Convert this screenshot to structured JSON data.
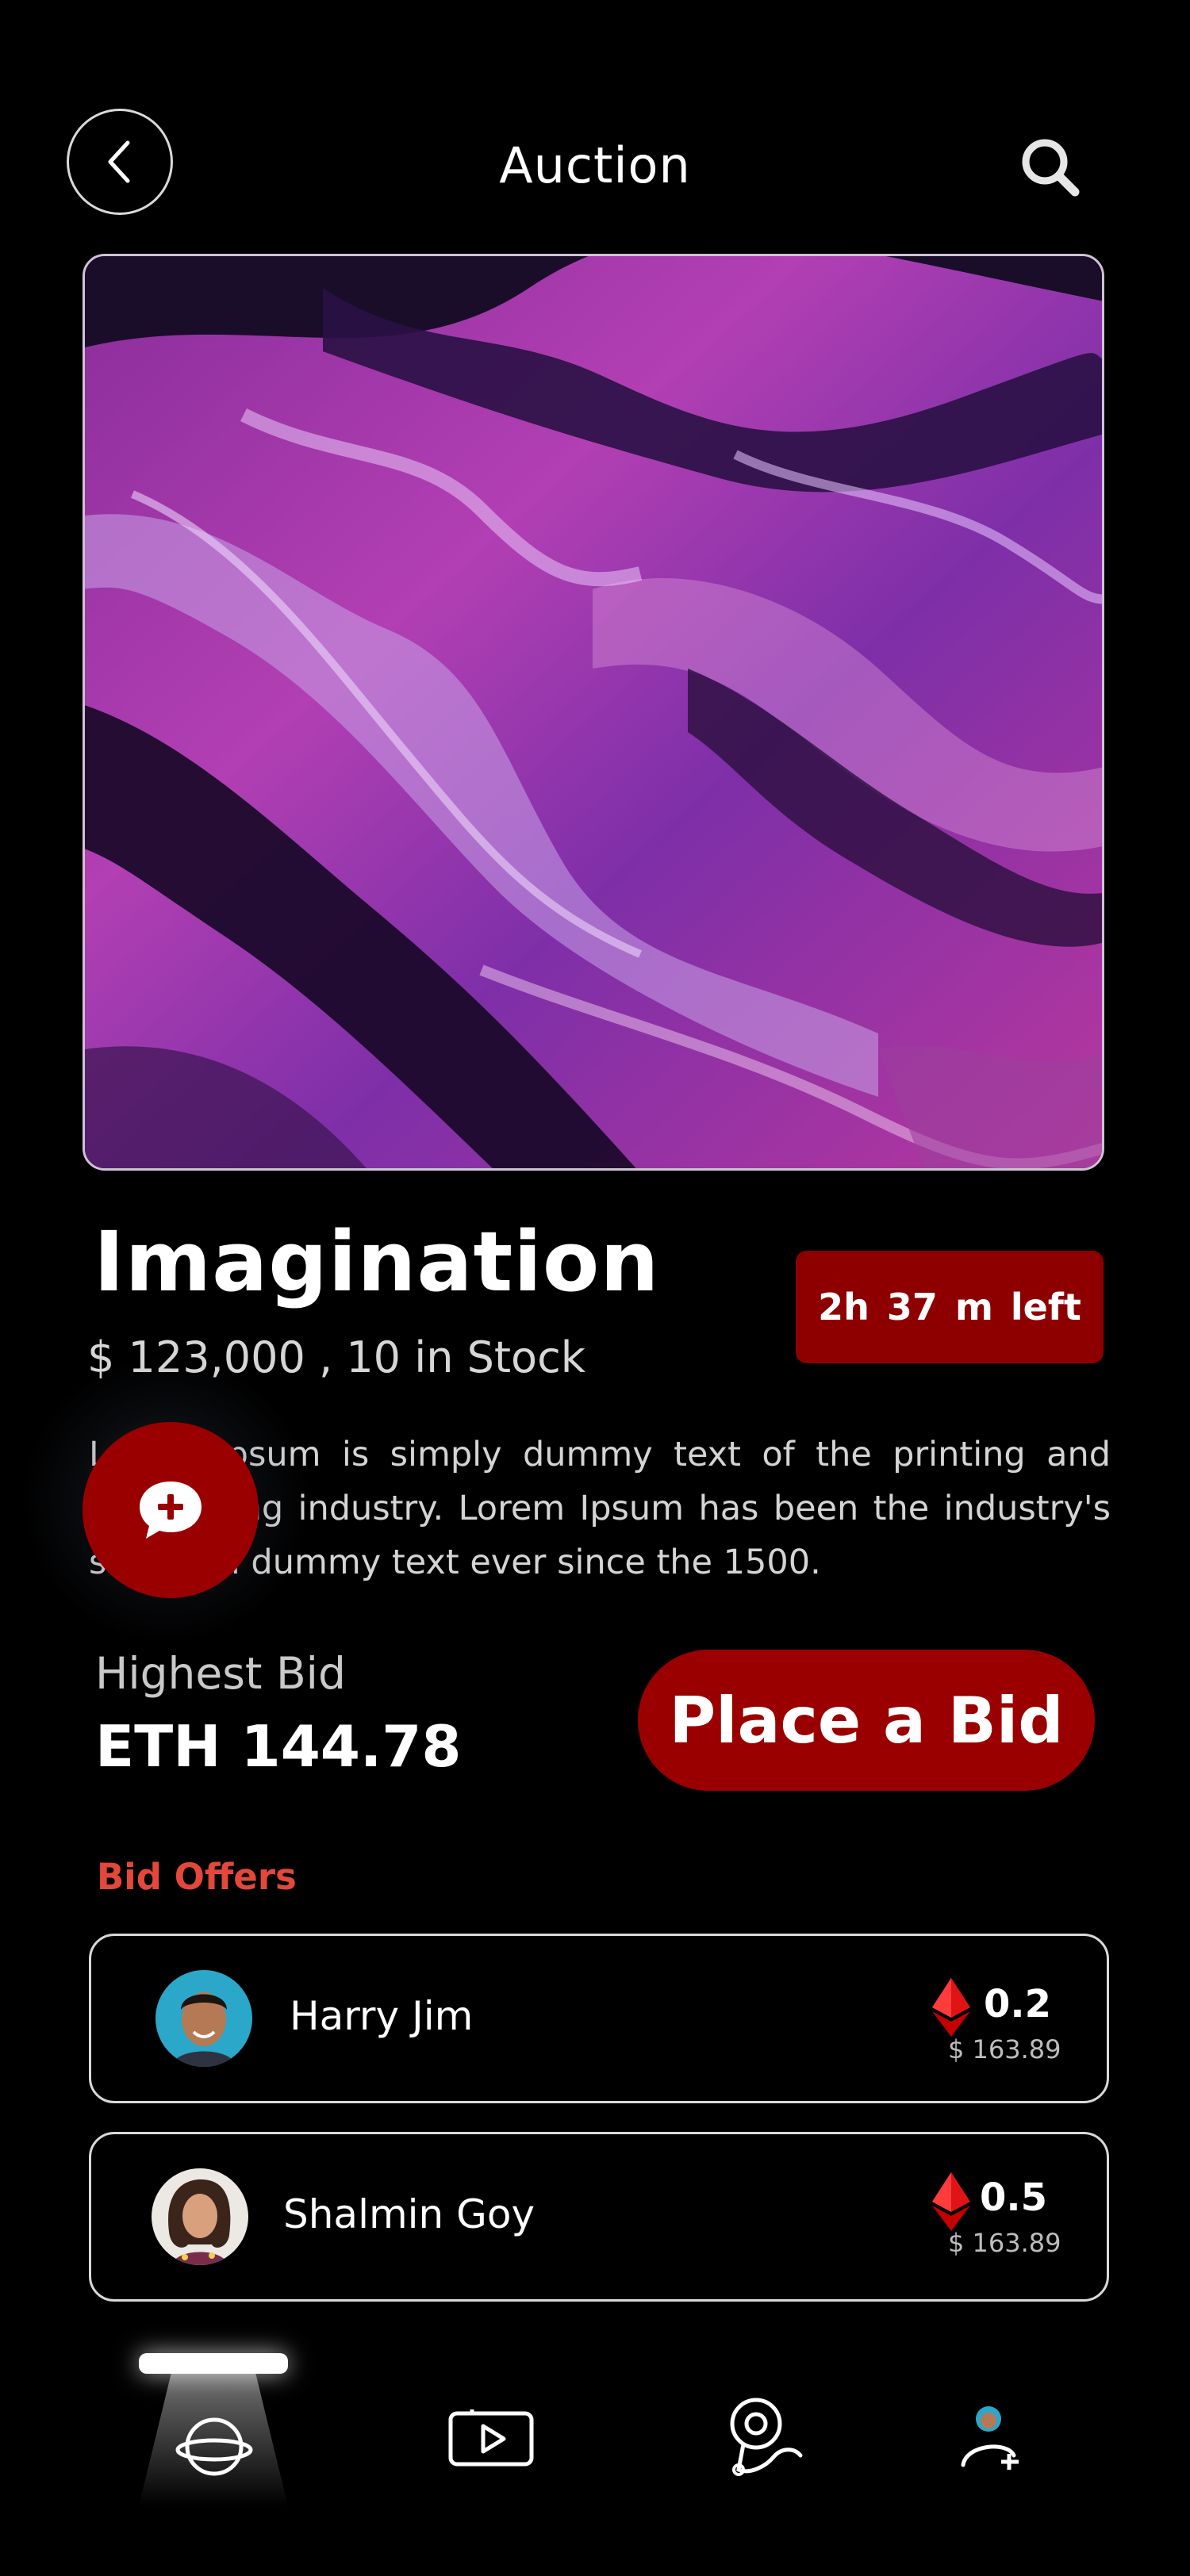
{
  "header": {
    "back_icon": "chevron-left-icon",
    "title": "Auction",
    "search_icon": "search-icon"
  },
  "item": {
    "title": "Imagination",
    "time_left": "2h  37 m  left",
    "price_stock": "$ 123,000 , 10 in Stock",
    "description": "Lorem Ipsum is simply dummy text of the printing and typesetting industry. Lorem Ipsum has been the industry's standard dummy text ever since the 1500."
  },
  "fab": {
    "icon": "chat-plus-icon"
  },
  "bid": {
    "highest_label": "Highest Bid",
    "highest_value": "ETH 144.78",
    "place_bid_label": "Place a Bid"
  },
  "offers": {
    "title": "Bid Offers",
    "items": [
      {
        "name": "Harry Jim",
        "amount": "0.2",
        "usd": "$ 163.89"
      },
      {
        "name": "Shalmin Goy",
        "amount": "0.5",
        "usd": "$ 163.89"
      }
    ]
  },
  "nav": {
    "items": [
      {
        "icon": "planet-icon",
        "active": true
      },
      {
        "icon": "video-play-icon",
        "active": false
      },
      {
        "icon": "location-route-icon",
        "active": false
      },
      {
        "icon": "add-user-icon",
        "active": false
      }
    ]
  },
  "colors": {
    "accent": "#9b0000",
    "background": "#000000",
    "offers_title": "#e3483b"
  }
}
